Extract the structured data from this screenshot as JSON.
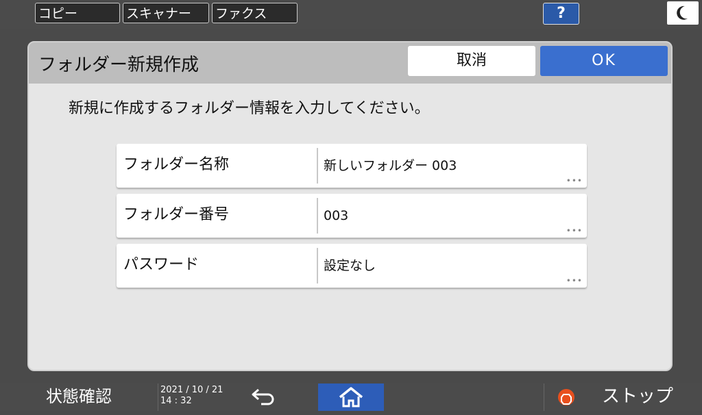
{
  "topbar": {
    "modes": [
      "コピー",
      "スキャナー",
      "ファクス"
    ],
    "help_label": "?"
  },
  "dialog": {
    "title": "フォルダー新規作成",
    "cancel_label": "取消",
    "ok_label": "OK",
    "instruction": "新規に作成するフォルダー情報を入力してください。",
    "fields": [
      {
        "label": "フォルダー名称",
        "value": "新しいフォルダー 003"
      },
      {
        "label": "フォルダー番号",
        "value": "003"
      },
      {
        "label": "パスワード",
        "value": "設定なし"
      }
    ],
    "more_glyph": "•••"
  },
  "bottombar": {
    "status_label": "状態確認",
    "date": "2021 / 10 / 21",
    "time": "14 : 32",
    "stop_label": "ストップ"
  },
  "colors": {
    "accent": "#3a6fcf",
    "home": "#2d5db8",
    "stop": "#e8501e"
  }
}
